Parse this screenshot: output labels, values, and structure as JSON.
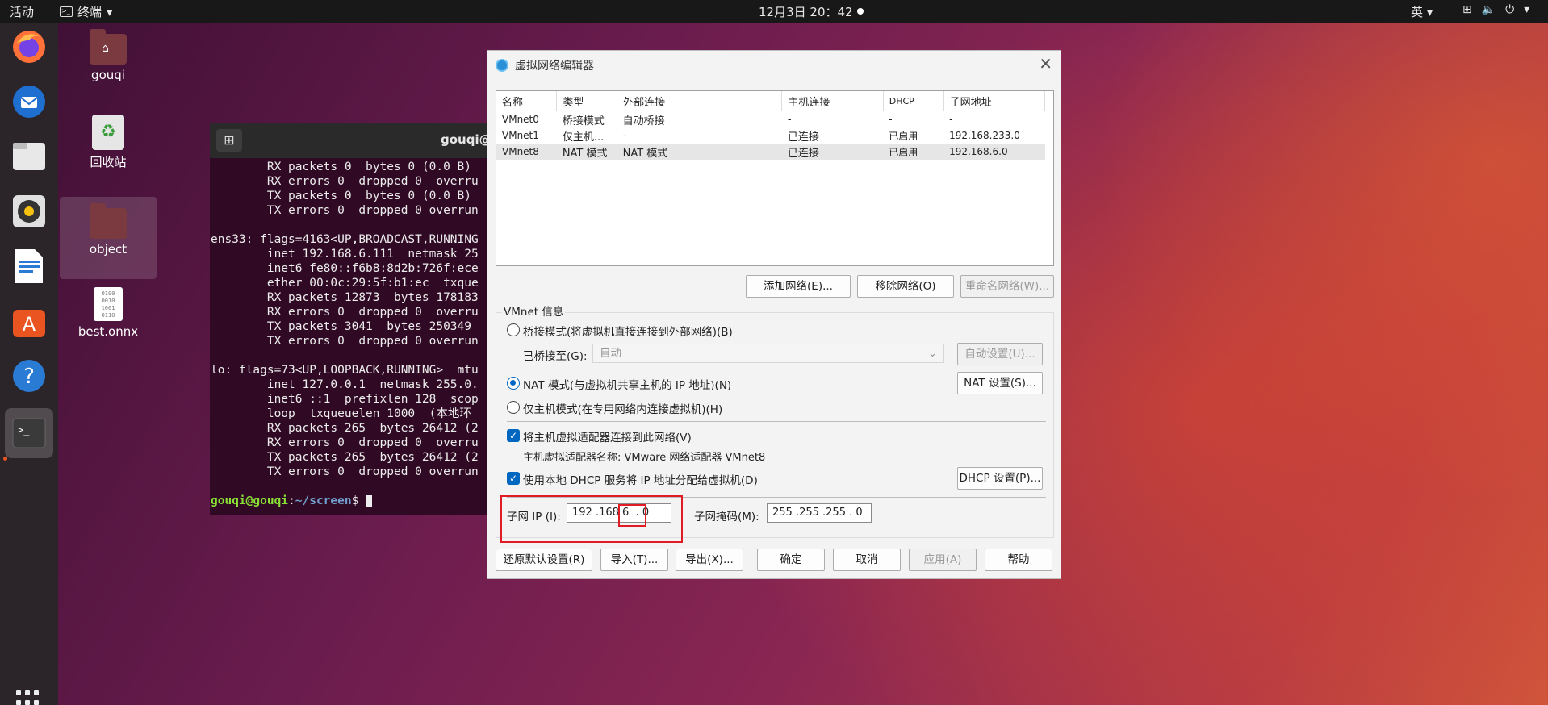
{
  "topbar": {
    "activities": "活动",
    "app_menu": "终端",
    "clock": "12月3日  20：42",
    "lang": "英"
  },
  "desktop": {
    "icons": [
      {
        "label": "gouqi"
      },
      {
        "label": "回收站"
      },
      {
        "label": "object"
      },
      {
        "label": "best.onnx"
      }
    ]
  },
  "terminal": {
    "title": "gouqi@gouqi: ~/screen",
    "lines": [
      "        RX packets 0  bytes 0 (0.0 B)",
      "        RX errors 0  dropped 0  overru",
      "        TX packets 0  bytes 0 (0.0 B)",
      "        TX errors 0  dropped 0 overrun",
      "",
      "ens33: flags=4163<UP,BROADCAST,RUNNING",
      "        inet 192.168.6.111  netmask 25",
      "        inet6 fe80::f6b8:8d2b:726f:ece",
      "        ether 00:0c:29:5f:b1:ec  txque",
      "        RX packets 12873  bytes 178183",
      "        RX errors 0  dropped 0  overru",
      "        TX packets 3041  bytes 250349",
      "        TX errors 0  dropped 0 overrun",
      "",
      "lo: flags=73<UP,LOOPBACK,RUNNING>  mtu",
      "        inet 127.0.0.1  netmask 255.0.",
      "        inet6 ::1  prefixlen 128  scop",
      "        loop  txqueuelen 1000  (本地环",
      "        RX packets 265  bytes 26412 (2",
      "        RX errors 0  dropped 0  overru",
      "        TX packets 265  bytes 26412 (2",
      "        TX errors 0  dropped 0 overrun",
      ""
    ],
    "prompt_user": "gouqi@gouqi",
    "prompt_sep": ":",
    "prompt_path": "~/screen",
    "prompt_end": "$ "
  },
  "dialog": {
    "title": "虚拟网络编辑器",
    "columns": [
      "名称",
      "类型",
      "外部连接",
      "主机连接",
      "DHCP",
      "子网地址"
    ],
    "rows": [
      [
        "VMnet0",
        "桥接模式",
        "自动桥接",
        "-",
        "-",
        "-"
      ],
      [
        "VMnet1",
        "仅主机...",
        "-",
        "已连接",
        "已启用",
        "192.168.233.0"
      ],
      [
        "VMnet8",
        "NAT 模式",
        "NAT 模式",
        "已连接",
        "已启用",
        "192.168.6.0"
      ]
    ],
    "buttons_list": {
      "add": "添加网络(E)...",
      "remove": "移除网络(O)",
      "rename": "重命名网络(W)..."
    },
    "group_label": "VMnet 信息",
    "bridge_label": "桥接模式(将虚拟机直接连接到外部网络)(B)",
    "bridged_to_label": "已桥接至(G):",
    "bridged_to_value": "自动",
    "auto_settings": "自动设置(U)...",
    "nat_label": "NAT 模式(与虚拟机共享主机的 IP 地址)(N)",
    "nat_settings": "NAT 设置(S)...",
    "hostonly_label": "仅主机模式(在专用网络内连接虚拟机)(H)",
    "connect_adapter_label": "将主机虚拟适配器连接到此网络(V)",
    "adapter_name_label": "主机虚拟适配器名称: VMware 网络适配器 VMnet8",
    "dhcp_label": "使用本地 DHCP 服务将 IP 地址分配给虚拟机(D)",
    "dhcp_settings": "DHCP 设置(P)...",
    "subnet_ip_label": "子网 IP (I):",
    "subnet_ip_a": "192 .168",
    "subnet_ip_b": " 6  . 0",
    "subnet_mask_label": "子网掩码(M):",
    "subnet_mask_value": "255 .255 .255 . 0",
    "bottom": {
      "restore": "还原默认设置(R)",
      "import": "导入(T)...",
      "export": "导出(X)...",
      "ok": "确定",
      "cancel": "取消",
      "apply": "应用(A)",
      "help": "帮助"
    }
  },
  "colors": {
    "accent": "#0067c0",
    "highlight_box": "#e01b24",
    "ubuntu_orange": "#e95420"
  }
}
